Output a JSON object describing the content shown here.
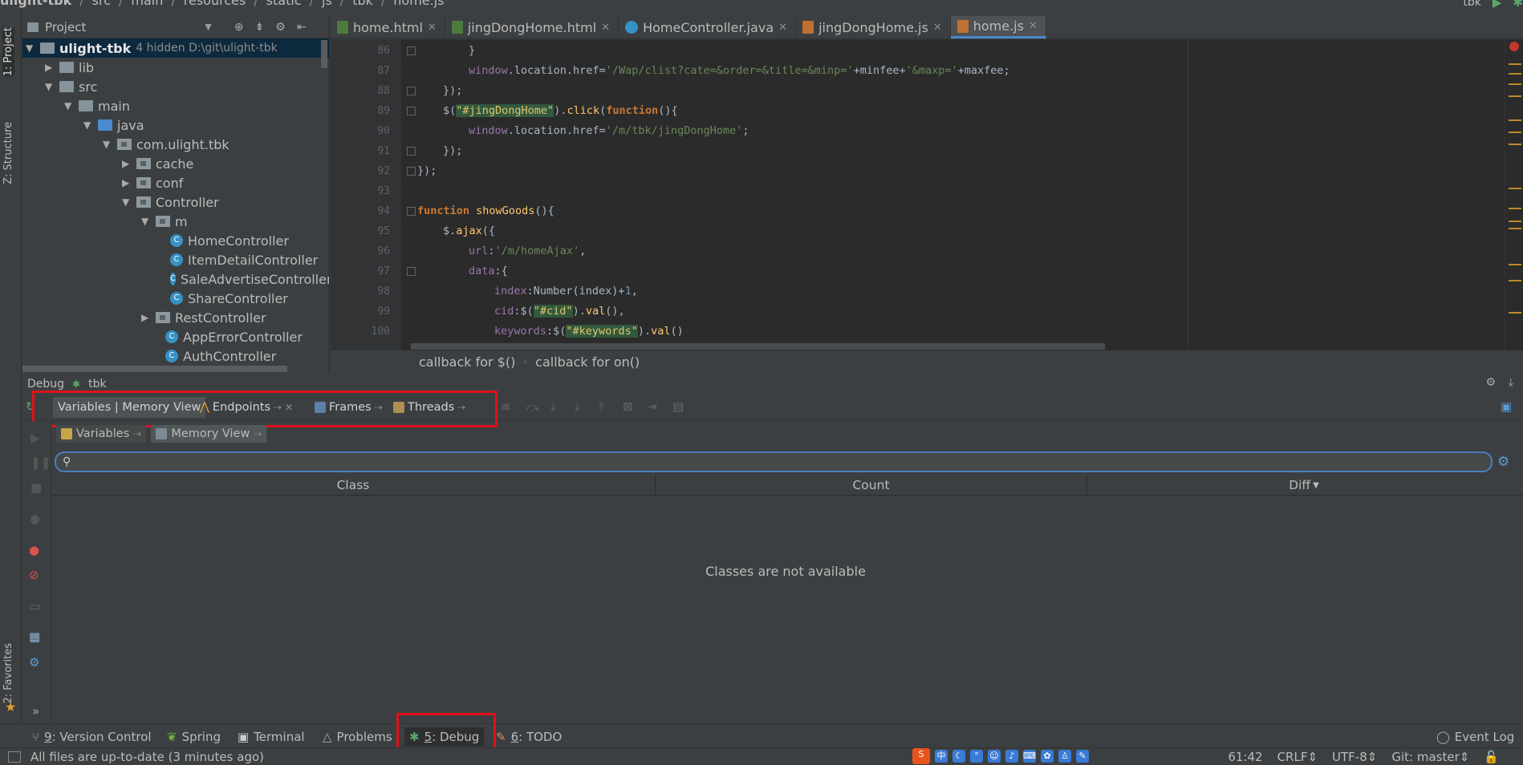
{
  "window": {
    "path_crumbs": [
      "ulight-tbk",
      "src",
      "main",
      "resources",
      "static",
      "js",
      "tbk",
      "home.js"
    ],
    "run_config": "tbk"
  },
  "left_stripe": {
    "project_label": "1: Project",
    "structure_label": "Z: Structure",
    "favorites_label": "2: Favorites"
  },
  "project": {
    "title": "Project",
    "tree": [
      {
        "label": "ulight-tbk",
        "hint": "4 hidden  D:\\git\\ulight-tbk"
      },
      {
        "label": "lib"
      },
      {
        "label": "src"
      },
      {
        "label": "main"
      },
      {
        "label": "java"
      },
      {
        "label": "com.ulight.tbk"
      },
      {
        "label": "cache"
      },
      {
        "label": "conf"
      },
      {
        "label": "Controller"
      },
      {
        "label": "m"
      },
      {
        "label": "HomeController"
      },
      {
        "label": "ItemDetailController"
      },
      {
        "label": "SaleAdvertiseController"
      },
      {
        "label": "ShareController"
      },
      {
        "label": "RestController"
      },
      {
        "label": "AppErrorController"
      },
      {
        "label": "AuthController"
      }
    ]
  },
  "editor": {
    "tabs": [
      {
        "label": "home.html",
        "type": "html"
      },
      {
        "label": "jingDongHome.html",
        "type": "html"
      },
      {
        "label": "HomeController.java",
        "type": "java"
      },
      {
        "label": "jingDongHome.js",
        "type": "js"
      },
      {
        "label": "home.js",
        "type": "js",
        "active": true
      }
    ],
    "line_numbers": [
      "86",
      "87",
      "88",
      "89",
      "90",
      "91",
      "92",
      "93",
      "94",
      "95",
      "96",
      "97",
      "98",
      "99",
      "100"
    ],
    "lines": {
      "l86": "}",
      "l87_a": "window",
      "l87_b": ".location.href=",
      "l87_c": "'/Wap/clist?cate=&order=&title=&minp='",
      "l87_d": "+minfee+",
      "l87_e": "'&maxp='",
      "l87_f": "+maxfee;",
      "l88": "});",
      "l89_a": "$(",
      "l89_b": "\"#jingDongHome\"",
      "l89_c": ").",
      "l89_d": "click",
      "l89_e": "(",
      "l89_f": "function",
      "l89_g": "(){",
      "l90_a": "window",
      "l90_b": ".location.href=",
      "l90_c": "'/m/tbk/jingDongHome'",
      "l90_d": ";",
      "l91": "});",
      "l92": "});",
      "l94_a": "function",
      "l94_b": "showGoods",
      "l94_c": "(){",
      "l95_a": "$.",
      "l95_b": "ajax",
      "l95_c": "({",
      "l96_a": "url",
      "l96_b": ":",
      "l96_c": "'/m/homeAjax'",
      "l96_d": ",",
      "l97_a": "data",
      "l97_b": ":{",
      "l98_a": "index",
      "l98_b": ":Number(index)+",
      "l98_c": "1",
      "l98_d": ",",
      "l99_a": "cid",
      "l99_b": ":$(",
      "l99_c": "\"#cid\"",
      "l99_d": ").",
      "l99_e": "val",
      "l99_f": "(),",
      "l100_a": "keywords",
      "l100_b": ":$(",
      "l100_c": "\"#keywords\"",
      "l100_d": ").",
      "l100_e": "val",
      "l100_f": "()"
    },
    "breadcrumbs": [
      "callback for $()",
      "callback for on()"
    ]
  },
  "debug": {
    "title": "Debug",
    "config": "tbk",
    "tabs": {
      "variables_memory": "Variables | Memory View",
      "endpoints": "Endpoints",
      "frames": "Frames",
      "threads": "Threads"
    },
    "subtabs": {
      "variables": "Variables",
      "memory_view": "Memory View"
    },
    "search_placeholder": "",
    "columns": {
      "class": "Class",
      "count": "Count",
      "diff": "Diff"
    },
    "empty_message": "Classes are not available"
  },
  "toolwindows": {
    "version_control_num": "9",
    "version_control": ": Version Control",
    "spring": "Spring",
    "terminal": "Terminal",
    "problems": "Problems",
    "debug_num": "5",
    "debug": ": Debug",
    "todo_num": "6",
    "todo": ": TODO",
    "event_log": "Event Log"
  },
  "status": {
    "message": "All files are up-to-date (3 minutes ago)",
    "position": "61:42",
    "line_sep": "CRLF",
    "encoding": "UTF-8",
    "vcs": "Git: master"
  },
  "ime": {
    "lang": "中"
  },
  "colors": {
    "highlight_box": "#e0101a",
    "accent": "#4a88c7",
    "selection": "#0d293e"
  }
}
